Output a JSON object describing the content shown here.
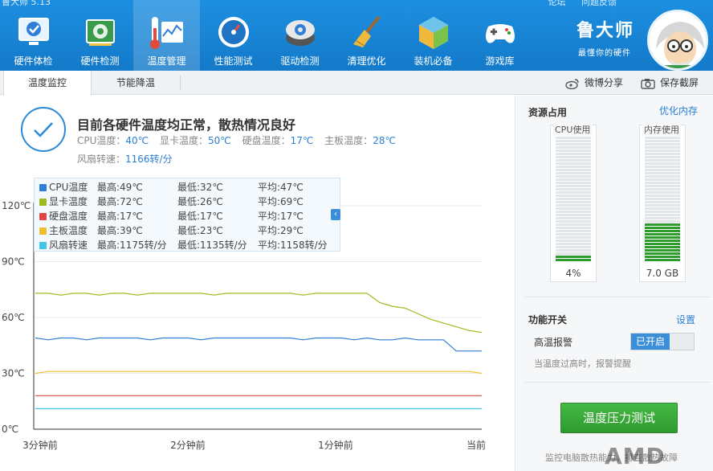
{
  "app": {
    "title": "鲁大师 5.13",
    "links": [
      "论坛",
      "问题反馈"
    ]
  },
  "brand": {
    "name": "鲁大师",
    "tagline": "最懂你的硬件"
  },
  "nav": [
    {
      "label": "硬件体检",
      "icon": "hardware-check-icon"
    },
    {
      "label": "硬件检测",
      "icon": "hardware-detect-icon"
    },
    {
      "label": "温度管理",
      "icon": "temperature-icon",
      "active": true
    },
    {
      "label": "性能测试",
      "icon": "speedometer-icon"
    },
    {
      "label": "驱动检测",
      "icon": "driver-icon"
    },
    {
      "label": "清理优化",
      "icon": "broom-icon"
    },
    {
      "label": "装机必备",
      "icon": "package-icon"
    },
    {
      "label": "游戏库",
      "icon": "gamepad-icon"
    }
  ],
  "tabs": {
    "monitor": "温度监控",
    "saving": "节能降温",
    "share": "微博分享",
    "screenshot": "保存截屏"
  },
  "status": {
    "title": "目前各硬件温度均正常，散热情况良好",
    "cpu_label": "CPU温度：",
    "cpu": "40℃",
    "gpu_label": "显卡温度：",
    "gpu": "50℃",
    "disk_label": "硬盘温度：",
    "disk": "17℃",
    "board_label": "主板温度：",
    "board": "28℃",
    "fan_label": "风扇转速：",
    "fan": "1166转/分"
  },
  "legend": [
    {
      "name": "CPU温度",
      "max": "最高:49℃",
      "min": "最低:32℃",
      "avg": "平均:47℃",
      "color": "#2f7fd8"
    },
    {
      "name": "显卡温度",
      "max": "最高:72℃",
      "min": "最低:26℃",
      "avg": "平均:69℃",
      "color": "#9dbb1c"
    },
    {
      "name": "硬盘温度",
      "max": "最高:17℃",
      "min": "最低:17℃",
      "avg": "平均:17℃",
      "color": "#e04545"
    },
    {
      "name": "主板温度",
      "max": "最高:39℃",
      "min": "最低:23℃",
      "avg": "平均:29℃",
      "color": "#f0be2c"
    },
    {
      "name": "风扇转速",
      "max": "最高:1175转/分",
      "min": "最低:1135转/分",
      "avg": "平均:1158转/分",
      "color": "#3fc4ea"
    }
  ],
  "chart_data": {
    "type": "line",
    "x": [
      "3分钟前",
      "2分钟前",
      "1分钟前",
      "当前"
    ],
    "yticks": [
      "120℃",
      "90℃",
      "60℃",
      "30℃",
      "0℃"
    ],
    "ylim": [
      0,
      120
    ],
    "series": [
      {
        "name": "显卡温度",
        "color": "#9dbb1c",
        "values": [
          73,
          73,
          72,
          73,
          73,
          72,
          73,
          73,
          72,
          73,
          73,
          73,
          73,
          73,
          72,
          73,
          73,
          73,
          73,
          73,
          73,
          72,
          73,
          73,
          73,
          73,
          73,
          68,
          66,
          65,
          62,
          59,
          57,
          55,
          53,
          52
        ]
      },
      {
        "name": "CPU温度",
        "color": "#2f7fd8",
        "values": [
          49,
          48,
          49,
          49,
          48,
          49,
          49,
          49,
          49,
          48,
          49,
          49,
          49,
          48,
          49,
          49,
          49,
          49,
          49,
          49,
          49,
          48,
          49,
          49,
          49,
          48,
          49,
          48,
          48,
          49,
          48,
          48,
          48,
          42,
          42,
          42
        ]
      },
      {
        "name": "主板温度",
        "color": "#f0be2c",
        "values": [
          30,
          31,
          31,
          31,
          31,
          31,
          31,
          31,
          31,
          31,
          31,
          31,
          31,
          31,
          31,
          31,
          31,
          31,
          31,
          31,
          31,
          31,
          31,
          31,
          31,
          31,
          31,
          31,
          31,
          31,
          31,
          31,
          31,
          31,
          31,
          30
        ]
      },
      {
        "name": "硬盘温度",
        "color": "#e04545",
        "values": [
          18,
          18,
          18,
          18,
          18,
          18,
          18,
          18,
          18,
          18,
          18,
          18,
          18,
          18,
          18,
          18,
          18,
          18,
          18,
          18,
          18,
          18,
          18,
          18,
          18,
          18,
          18,
          18,
          18,
          18,
          18,
          18,
          18,
          18,
          18,
          18
        ]
      },
      {
        "name": "风扇转速",
        "color": "#3fc4ea",
        "values": [
          11,
          11,
          11,
          11,
          11,
          11,
          11,
          11,
          11,
          11,
          11,
          11,
          11,
          11,
          11,
          11,
          11,
          11,
          11,
          11,
          11,
          11,
          11,
          11,
          11,
          11,
          11,
          11,
          11,
          11,
          11,
          11,
          11,
          11,
          11,
          11
        ]
      }
    ]
  },
  "side": {
    "resource_title": "资源占用",
    "optimize_link": "优化内存",
    "cpu_label": "CPU使用",
    "cpu_value": "4%",
    "cpu_fraction": 0.04,
    "mem_label": "内存使用",
    "mem_value": "7.0 GB",
    "mem_fraction": 0.3,
    "switch_title": "功能开关",
    "settings_link": "设置",
    "alarm_label": "高温报警",
    "alarm_state": "已开启",
    "alarm_hint": "当温度过高时，报警提醒",
    "stress_button": "温度压力测试",
    "footer": "监控电脑散热能力，排查散热故障",
    "overlay_text": "AMD"
  }
}
